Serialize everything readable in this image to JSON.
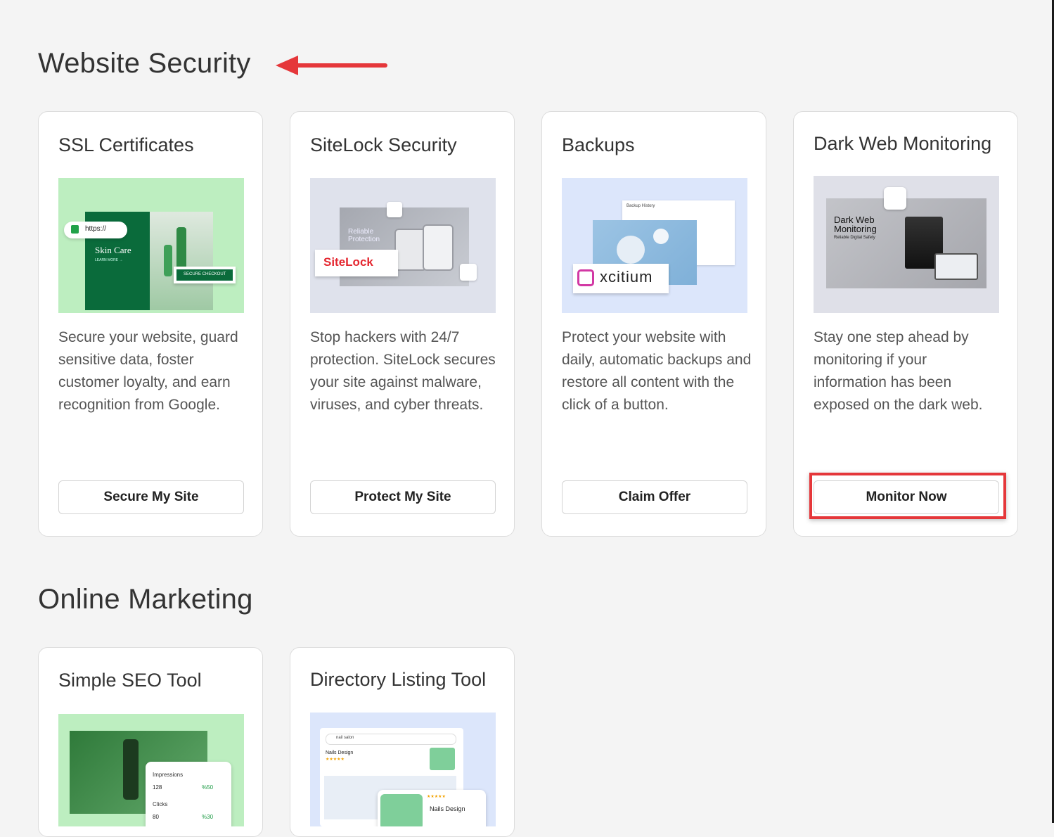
{
  "sections": {
    "security_title": "Website Security",
    "marketing_title": "Online Marketing"
  },
  "security_cards": [
    {
      "title": "SSL Certificates",
      "description": "Secure your website, guard sensitive data, foster customer loyalty, and earn recognition from Google.",
      "button": "Secure My Site",
      "image": {
        "url_text": "https://",
        "brand": "Skin Care",
        "cta": "LEARN MORE →",
        "checkout": "SECURE CHECKOUT"
      }
    },
    {
      "title": "SiteLock Security",
      "description": "Stop hackers with 24/7 protection. SiteLock secures your site against malware, viruses, and cyber threats.",
      "button": "Protect My Site",
      "image": {
        "caption_1": "Reliable",
        "caption_2": "Protection",
        "logo": "SiteLock"
      }
    },
    {
      "title": "Backups",
      "description": "Protect your website with daily, automatic backups and restore all content with the click of a button.",
      "button": "Claim Offer",
      "image": {
        "panel": "Backup History",
        "logo": "xcitium"
      }
    },
    {
      "title": "Dark Web Monitoring",
      "description": "Stay one step ahead by monitoring if your information has been exposed on the dark web.",
      "button": "Monitor Now",
      "image": {
        "line_1": "Dark Web",
        "line_2": "Monitoring",
        "tagline": "Reliable Digital Safety"
      }
    }
  ],
  "marketing_cards": [
    {
      "title": "Simple SEO Tool",
      "image": {
        "impressions_label": "Impressions",
        "impressions_value": "128",
        "impressions_change": "%50",
        "clicks_label": "Clicks",
        "clicks_value": "80",
        "clicks_change": "%30"
      }
    },
    {
      "title": "Directory Listing Tool",
      "image": {
        "search": "nail salon",
        "listing_1": "Nails Design",
        "listing_2": "Nails Design",
        "stars": "★★★★★"
      }
    }
  ],
  "colors": {
    "background": "#f4f4f4",
    "card": "#ffffff",
    "annotation_red": "#e5373a",
    "green_bg": "#bdeec0",
    "dark_green": "#0a6b3b",
    "blue_bg": "#dce6fb",
    "sitelock_red": "#e4262f"
  }
}
